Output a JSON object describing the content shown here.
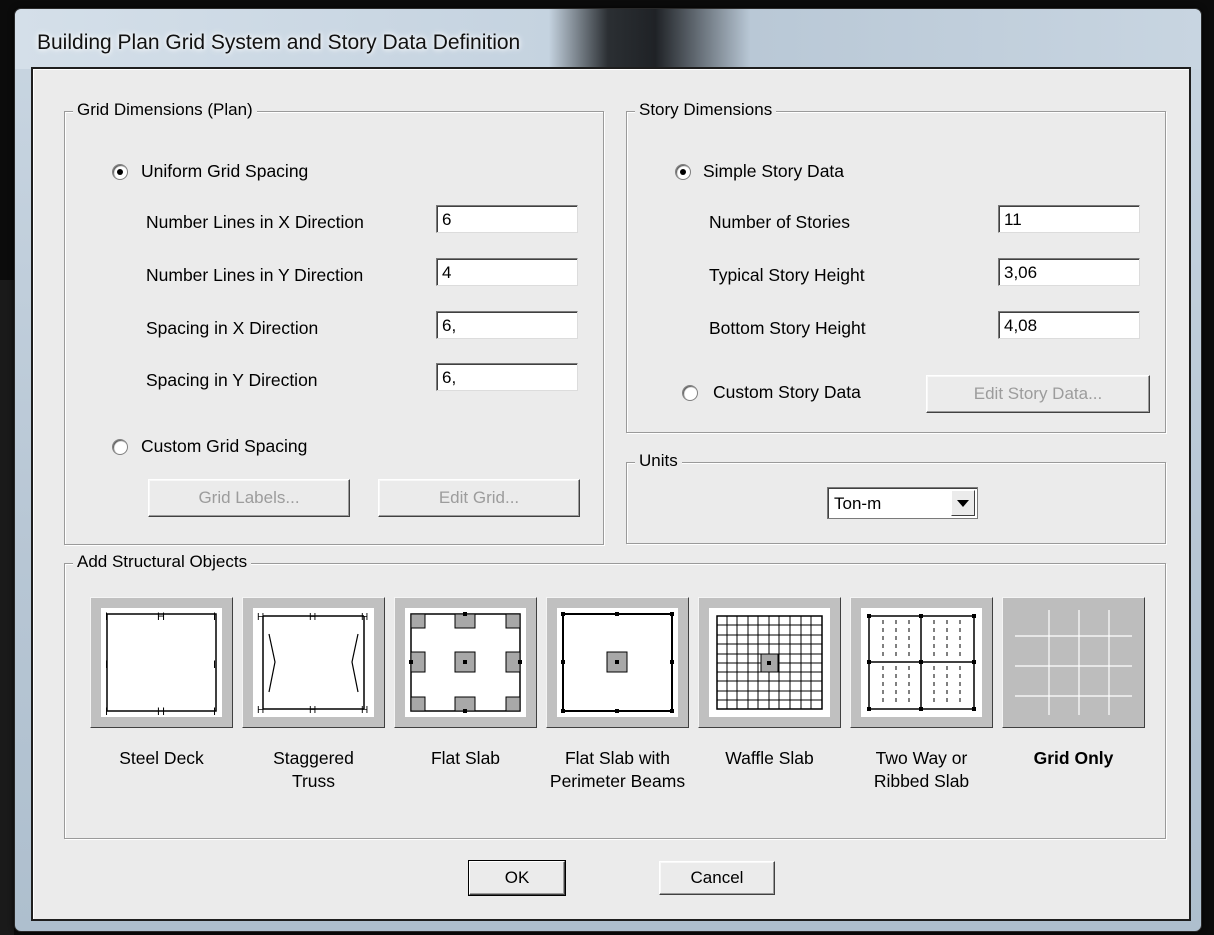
{
  "window": {
    "title": "Building Plan Grid System and Story Data Definition"
  },
  "grid": {
    "legend": "Grid Dimensions (Plan)",
    "uniform_label": "Uniform Grid Spacing",
    "rows": [
      {
        "label": "Number Lines in X Direction",
        "value": "6"
      },
      {
        "label": "Number Lines in Y Direction",
        "value": "4"
      },
      {
        "label": "Spacing in X Direction",
        "value": "6,"
      },
      {
        "label": "Spacing in Y Direction",
        "value": "6,"
      }
    ],
    "custom_label": "Custom Grid Spacing",
    "grid_labels_button": "Grid Labels...",
    "edit_grid_button": "Edit Grid..."
  },
  "story": {
    "legend": "Story Dimensions",
    "simple_label": "Simple Story Data",
    "rows": [
      {
        "label": "Number of Stories",
        "value": "11"
      },
      {
        "label": "Typical Story Height",
        "value": "3,06"
      },
      {
        "label": "Bottom Story Height",
        "value": "4,08"
      }
    ],
    "custom_label": "Custom Story Data",
    "edit_button": "Edit Story Data..."
  },
  "units": {
    "legend": "Units",
    "selected": "Ton-m"
  },
  "objects": {
    "legend": "Add Structural Objects",
    "items": [
      {
        "line1": "Steel Deck",
        "line2": ""
      },
      {
        "line1": "Staggered",
        "line2": "Truss"
      },
      {
        "line1": "Flat Slab",
        "line2": ""
      },
      {
        "line1": "Flat Slab with",
        "line2": "Perimeter Beams"
      },
      {
        "line1": "Waffle Slab",
        "line2": ""
      },
      {
        "line1": "Two Way or",
        "line2": "Ribbed Slab"
      },
      {
        "line1": "Grid Only",
        "line2": ""
      }
    ]
  },
  "buttons": {
    "ok": "OK",
    "cancel": "Cancel"
  },
  "icons": [
    "radio-selected-icon",
    "radio-unselected-icon",
    "dropdown-arrow-icon",
    "steel-deck-icon",
    "staggered-truss-icon",
    "flat-slab-icon",
    "flat-slab-perimeter-icon",
    "waffle-slab-icon",
    "two-way-slab-icon",
    "grid-only-icon"
  ]
}
